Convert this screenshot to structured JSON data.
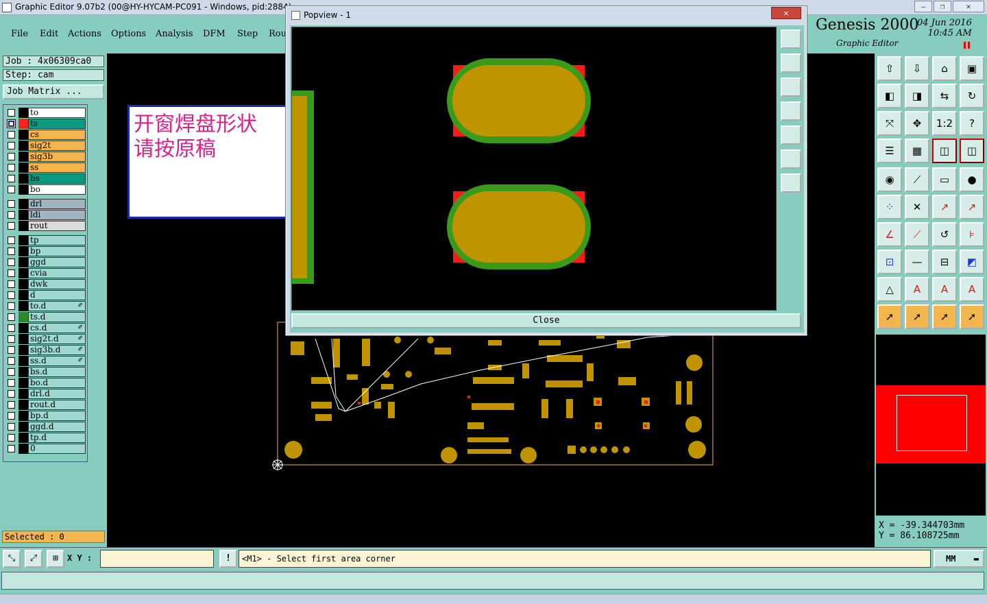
{
  "window": {
    "title": "Graphic Editor 9.07b2 (00@HY-HYCAM-PC091 - Windows, pid:2884)"
  },
  "menu": [
    "File",
    "Edit",
    "Actions",
    "Options",
    "Analysis",
    "DFM",
    "Step",
    "Rou"
  ],
  "brand": {
    "name": "Genesis 2000",
    "subtitle": "Graphic Editor",
    "date": "04 Jun 2016",
    "time": "10:45 AM"
  },
  "job": {
    "job_label": "Job  : 4x06309ca0",
    "step_label": "Step: cam",
    "matrix_button": "Job Matrix ..."
  },
  "layers": [
    {
      "name": "to",
      "color": "#ffffff",
      "swatch": "#000000",
      "checked": false,
      "group": 1
    },
    {
      "name": "ts",
      "color": "#0a9a80",
      "swatch": "#ff2020",
      "checked": true,
      "group": 1
    },
    {
      "name": "cs",
      "color": "#f4b54c",
      "swatch": "#000000",
      "checked": false,
      "group": 1
    },
    {
      "name": "sig2t",
      "color": "#f4b54c",
      "swatch": "#000000",
      "checked": false,
      "group": 1
    },
    {
      "name": "sig3b",
      "color": "#f4b54c",
      "swatch": "#000000",
      "checked": false,
      "group": 1
    },
    {
      "name": "ss",
      "color": "#f4b54c",
      "swatch": "#000000",
      "checked": false,
      "group": 1
    },
    {
      "name": "bs",
      "color": "#0a9a80",
      "swatch": "#000000",
      "checked": false,
      "group": 1
    },
    {
      "name": "bo",
      "color": "#ffffff",
      "swatch": "#000000",
      "checked": false,
      "group": 1
    },
    {
      "name": "drl",
      "color": "#9fb6c0",
      "swatch": "#000000",
      "checked": false,
      "group": 2
    },
    {
      "name": "ldi",
      "color": "#9fb6c0",
      "swatch": "#000000",
      "checked": false,
      "group": 2
    },
    {
      "name": "rout",
      "color": "#d8dcdc",
      "swatch": "#000000",
      "checked": false,
      "group": 2
    },
    {
      "name": "tp",
      "color": "#9fd8d2",
      "swatch": "#000000",
      "checked": false,
      "group": 3
    },
    {
      "name": "bp",
      "color": "#9fd8d2",
      "swatch": "#000000",
      "checked": false,
      "group": 3
    },
    {
      "name": "ggd",
      "color": "#9fd8d2",
      "swatch": "#000000",
      "checked": false,
      "group": 3
    },
    {
      "name": "cvia",
      "color": "#9fd8d2",
      "swatch": "#000000",
      "checked": false,
      "group": 3
    },
    {
      "name": "dwk",
      "color": "#9fd8d2",
      "swatch": "#000000",
      "checked": false,
      "group": 3
    },
    {
      "name": "d",
      "color": "#9fd8d2",
      "swatch": "#000000",
      "checked": false,
      "group": 3
    },
    {
      "name": "to.d",
      "color": "#9fd8d2",
      "swatch": "#000000",
      "checked": false,
      "group": 3,
      "mark": "✐"
    },
    {
      "name": "ts.d",
      "color": "#9fd8d2",
      "swatch": "#2a8a2a",
      "checked": false,
      "group": 3
    },
    {
      "name": "cs.d",
      "color": "#9fd8d2",
      "swatch": "#000000",
      "checked": false,
      "group": 3,
      "mark": "✐"
    },
    {
      "name": "sig2t.d",
      "color": "#9fd8d2",
      "swatch": "#000000",
      "checked": false,
      "group": 3,
      "mark": "✐"
    },
    {
      "name": "sig3b.d",
      "color": "#9fd8d2",
      "swatch": "#000000",
      "checked": false,
      "group": 3,
      "mark": "✐"
    },
    {
      "name": "ss.d",
      "color": "#9fd8d2",
      "swatch": "#000000",
      "checked": false,
      "group": 3,
      "mark": "✐"
    },
    {
      "name": "bs.d",
      "color": "#9fd8d2",
      "swatch": "#000000",
      "checked": false,
      "group": 3
    },
    {
      "name": "bo.d",
      "color": "#9fd8d2",
      "swatch": "#000000",
      "checked": false,
      "group": 3
    },
    {
      "name": "drl.d",
      "color": "#9fd8d2",
      "swatch": "#000000",
      "checked": false,
      "group": 3
    },
    {
      "name": "rout.d",
      "color": "#9fd8d2",
      "swatch": "#000000",
      "checked": false,
      "group": 3
    },
    {
      "name": "bp.d",
      "color": "#9fd8d2",
      "swatch": "#000000",
      "checked": false,
      "group": 3
    },
    {
      "name": "ggd.d",
      "color": "#9fd8d2",
      "swatch": "#000000",
      "checked": false,
      "group": 3
    },
    {
      "name": "tp.d",
      "color": "#9fd8d2",
      "swatch": "#000000",
      "checked": false,
      "group": 3
    },
    {
      "name": "0",
      "color": "#9fd8d2",
      "swatch": "#000000",
      "checked": false,
      "group": 3
    }
  ],
  "selected_label": "Selected : 0",
  "note": {
    "text_line1": "开窗焊盘形状",
    "text_line2": "请按原稿"
  },
  "popup": {
    "title": "Popview - 1",
    "close_x": "✕",
    "close_button": "Close"
  },
  "toolbar_icons": [
    "home-layer-icon",
    "save-layer-icon",
    "house-icon",
    "window-icon",
    "move-left-icon",
    "move-right-icon",
    "mirror-icon",
    "rotate-icon",
    "fit-icon",
    "center-icon",
    "ratio-icon",
    "help-icon",
    "filter-icon",
    "grid-icon",
    "layer-a-icon",
    "layer-b-icon",
    "snap-icon",
    "line-icon",
    "ruler-icon",
    "pad-icon",
    "nodes-icon",
    "cross-icon",
    "move-point-icon",
    "add-point-icon",
    "draw-line-icon",
    "draw-arc-icon",
    "undo-arc-icon",
    "feature-icon",
    "select-box-icon",
    "minus-icon",
    "resize-icon",
    "shape-icon",
    "text-a-icon",
    "text-b-icon",
    "text-c-icon",
    "text-d-icon",
    "pointer-icon",
    "pointer-box-icon",
    "pointer-circle-icon",
    "pointer-path-icon"
  ],
  "toolbar_labels": {
    "ratio": "1:2",
    "help": "?"
  },
  "coordinates": {
    "x": "X = -39.344703mm",
    "y": "Y = 86.108725mm"
  },
  "status": {
    "xy_label": "X Y :",
    "xy_value": "",
    "prompt": "<M1> - Select first area corner",
    "units": "MM",
    "info": "!"
  },
  "colors": {
    "panel": "#86cdc0",
    "pad_fill": "#c09400",
    "pad_outline": "#3a9a1a",
    "pad_corner": "#ff1a1a",
    "note_text": "#d6208a"
  }
}
